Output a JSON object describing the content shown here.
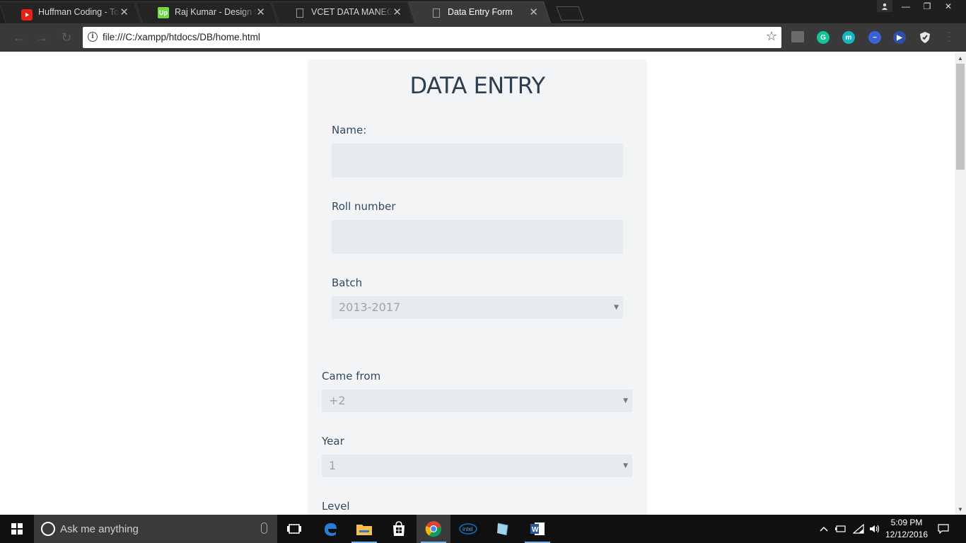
{
  "browser": {
    "tabs": [
      {
        "title": "Huffman Coding - To Ca",
        "icon": "youtube-icon",
        "active": false
      },
      {
        "title": "Raj Kumar - Design to m",
        "icon": "upwork-icon",
        "active": false
      },
      {
        "title": "VCET DATA MANEGEME",
        "icon": "page-icon",
        "active": false
      },
      {
        "title": "Data Entry Form",
        "icon": "page-icon",
        "active": true
      }
    ],
    "close_glyph": "✕",
    "url": "file:///C:/xampp/htdocs/DB/home.html",
    "info_glyph": "i",
    "star_glyph": "☆",
    "back_glyph": "←",
    "forward_glyph": "→",
    "reload_glyph": "↻",
    "extensions": [
      {
        "name": "cast-icon",
        "color": "#6b6b6b"
      },
      {
        "name": "grammarly-icon",
        "color": "#15c39a"
      },
      {
        "name": "m-extension-icon",
        "color": "#17b3c1"
      },
      {
        "name": "sync-extension-icon",
        "color": "#3a62d6"
      },
      {
        "name": "play-extension-icon",
        "color": "#2f4ea6"
      },
      {
        "name": "shield-extension-icon",
        "color": "#e8e8e8"
      }
    ],
    "window_controls": {
      "minimize": "—",
      "maximize": "❐",
      "close": "✕",
      "profile": "👤"
    }
  },
  "form": {
    "title": "DATA ENTRY",
    "name_label": "Name:",
    "name_value": "",
    "roll_label": "Roll number",
    "roll_value": "",
    "batch_label": "Batch",
    "batch_selected": "2013-2017",
    "came_from_label": "Came from",
    "came_from_selected": "+2",
    "year_label": "Year",
    "year_selected": "1",
    "level_label": "Level",
    "caret": "▼"
  },
  "taskbar": {
    "search_placeholder": "Ask me anything",
    "apps": [
      "task-view-icon",
      "edge-icon",
      "file-explorer-icon",
      "store-icon",
      "chrome-icon",
      "intel-icon",
      "app-icon",
      "word-icon"
    ],
    "time": "5:09 PM",
    "date": "12/12/2016"
  },
  "colors": {
    "accent": "#2c3e50",
    "card_bg": "#f2f4f5",
    "field_bg": "#e8ebed"
  }
}
